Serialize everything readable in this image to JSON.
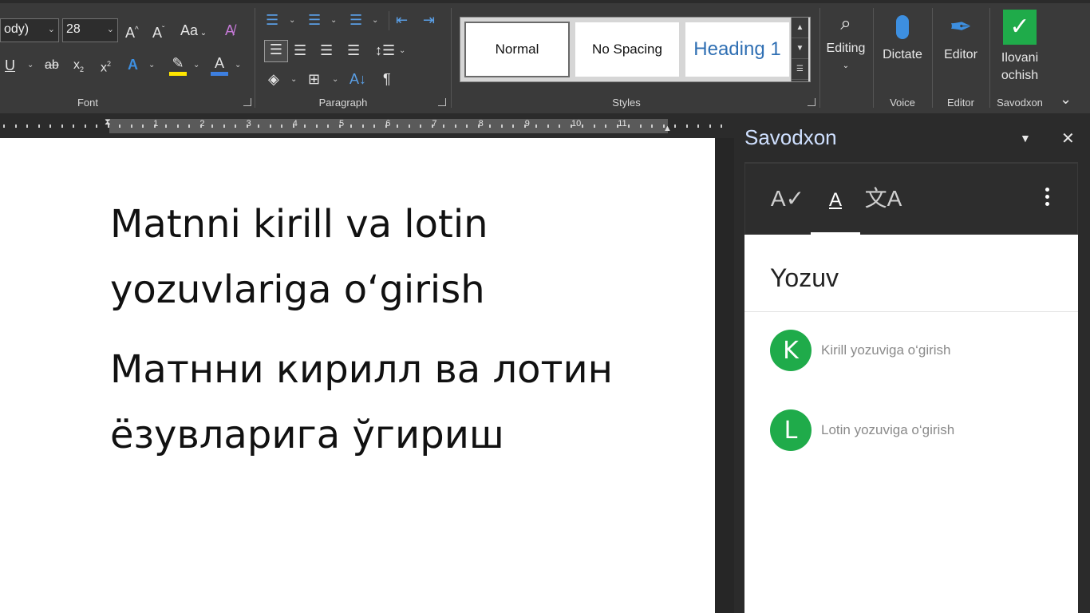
{
  "font": {
    "font_name_value": "ody)",
    "font_size_value": "28",
    "group_label": "Font"
  },
  "paragraph": {
    "group_label": "Paragraph"
  },
  "styles": {
    "group_label": "Styles",
    "tiles": [
      "Normal",
      "No Spacing",
      "Heading 1"
    ],
    "heading_color": "#2f6fb3"
  },
  "editing": {
    "label": "Editing"
  },
  "voice": {
    "button_label": "Dictate",
    "group_label": "Voice"
  },
  "editor": {
    "button_label": "Editor",
    "group_label": "Editor"
  },
  "savodxon_ribbon": {
    "button_label_line1": "Ilovani",
    "button_label_line2": "ochish",
    "group_label": "Savodxon"
  },
  "ruler": {
    "numbers": [
      "1",
      "2",
      "3",
      "4",
      "5",
      "6",
      "7",
      "8",
      "9",
      "10",
      "11"
    ]
  },
  "document": {
    "lines": [
      "Matnni kirill va lotin",
      "yozuvlariga o‘girish",
      "Матнни кирилл ва лотин",
      "ёзувларига ўгириш"
    ]
  },
  "pane": {
    "title": "Savodxon",
    "tabs": [
      "spell-check-tab",
      "script-tab",
      "translate-tab"
    ],
    "section_title": "Yozuv",
    "actions": [
      {
        "letter": "K",
        "label": "Kirill yozuviga o‘girish"
      },
      {
        "letter": "L",
        "label": "Lotin yozuviga o‘girish"
      }
    ],
    "accent_color": "#1fab4a"
  }
}
